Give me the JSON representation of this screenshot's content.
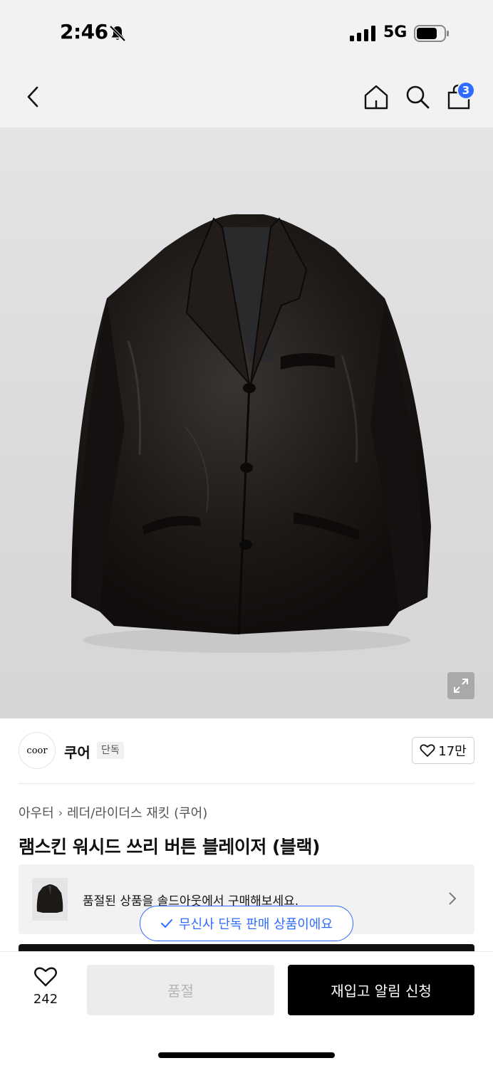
{
  "status_bar": {
    "time": "2:46",
    "network": "5G"
  },
  "nav": {
    "cart_count": "3"
  },
  "brand": {
    "logo_text": "coor",
    "name": "쿠어",
    "tag": "단독",
    "like_count": "17만"
  },
  "breadcrumb": {
    "category": "아우터",
    "subcategory": "레더/라이더스 재킷 (쿠어)"
  },
  "product": {
    "title": "램스킨 워시드 쓰리 버튼 블레이저 (블랙)"
  },
  "soldout_banner": {
    "text": "품절된 상품을 솔드아웃에서 구매해보세요."
  },
  "toast": {
    "text": "무신사 단독 판매 상품이에요"
  },
  "bottom_bar": {
    "wish_count": "242",
    "soldout_label": "품절",
    "restock_label": "재입고 알림 신청"
  },
  "colors": {
    "accent": "#2f6bff",
    "primary_button": "#000000",
    "disabled_button": "#ececec"
  }
}
